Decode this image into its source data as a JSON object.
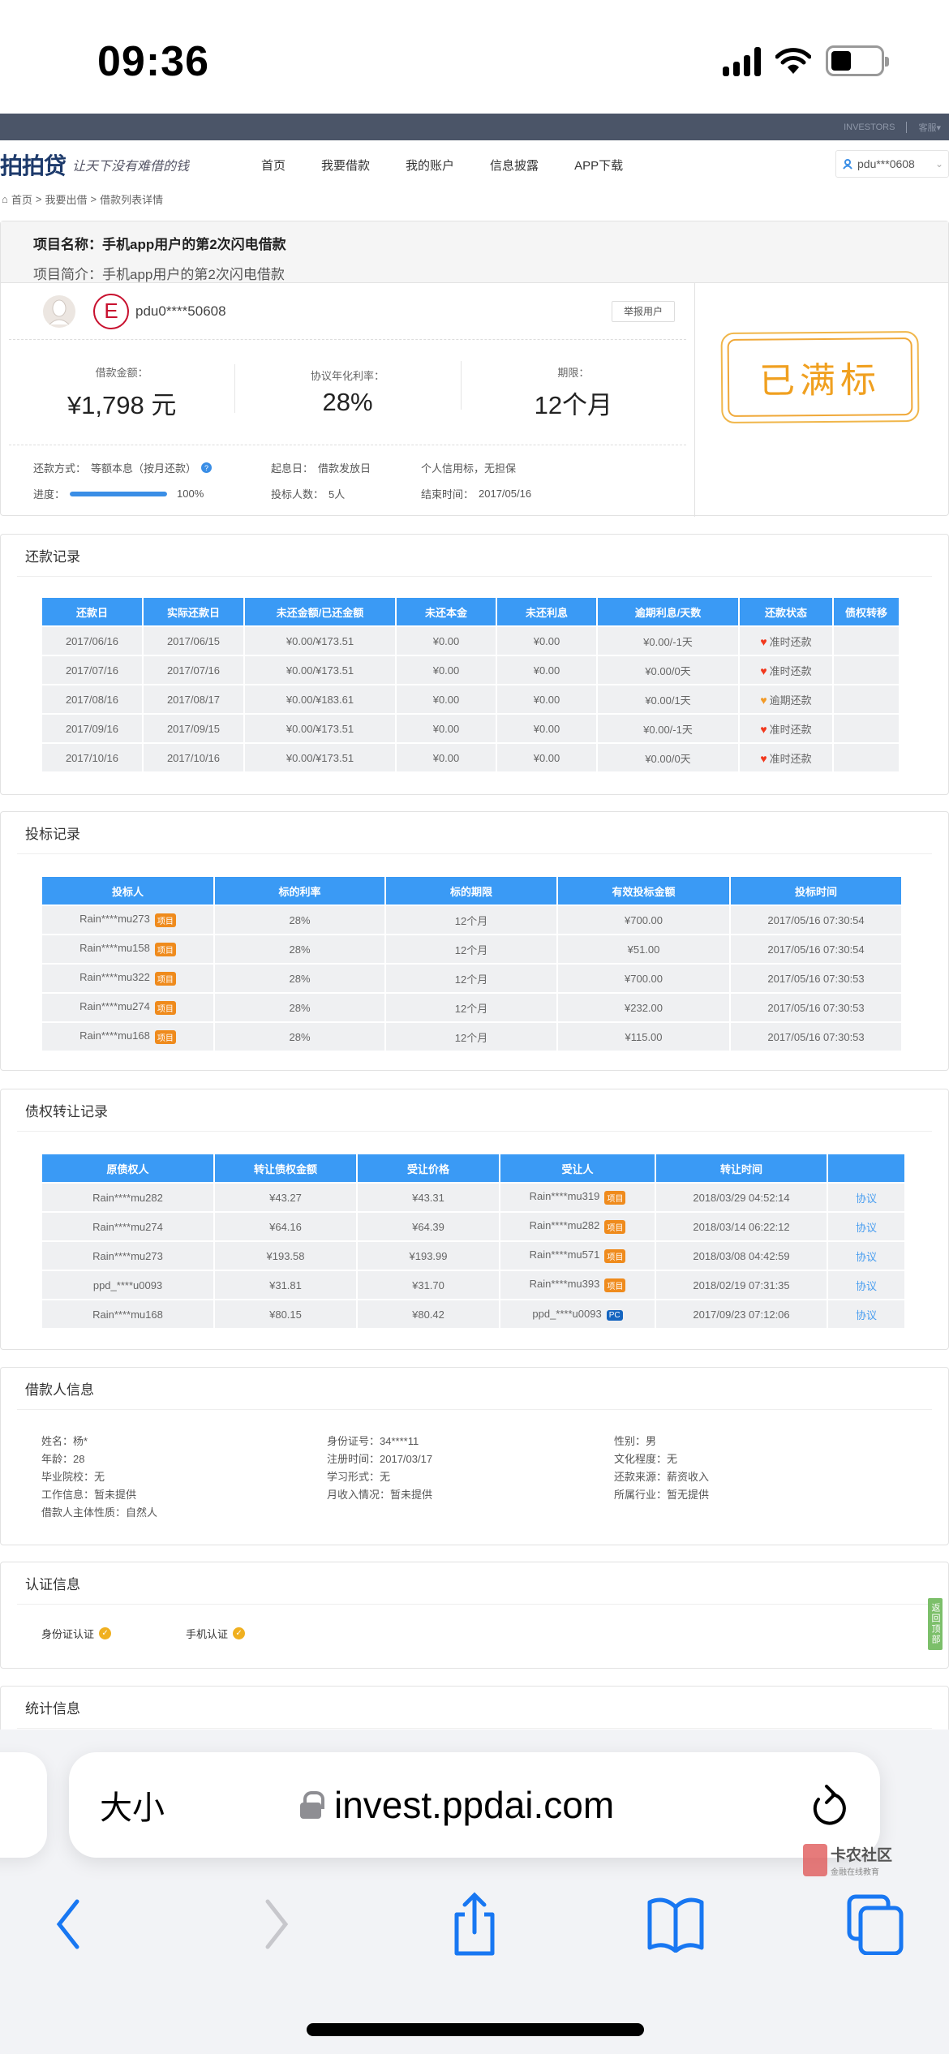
{
  "status_bar": {
    "time": "09:36"
  },
  "site": {
    "topbar": {
      "investors": "INVESTORS",
      "service": "客服"
    },
    "logo": "拍拍贷",
    "slogan": "让天下没有难借的钱",
    "nav": [
      "首页",
      "我要借款",
      "我的账户",
      "信息披露",
      "APP下载"
    ],
    "user": "pdu***0608",
    "breadcrumb": [
      "首页",
      "我要出借",
      "借款列表详情"
    ],
    "breadcrumb_sep": ">"
  },
  "project": {
    "name_label": "项目名称：",
    "name": "手机app用户的第2次闪电借款",
    "intro_label": "项目简介：",
    "intro": "手机app用户的第2次闪电借款",
    "borrower_level": "E",
    "borrower": "pdu0****50608",
    "report_button": "举报用户",
    "stats": [
      {
        "label": "借款金额：",
        "value": "¥1,798 元"
      },
      {
        "label": "协议年化利率：",
        "value": "28%"
      },
      {
        "label": "期限：",
        "value": "12个月"
      }
    ],
    "repay_method_label": "还款方式：",
    "repay_method": "等额本息（按月还款）",
    "interest_start_label": "起息日：",
    "interest_start": "借款发放日",
    "loan_type": "个人信用标，无担保",
    "progress_label": "进度：",
    "progress_percent": 100,
    "progress_text": "100%",
    "bidders_label": "投标人数：",
    "bidders": "5人",
    "end_time_label": "结束时间：",
    "end_time": "2017/05/16",
    "stamp": "已满标"
  },
  "repayment": {
    "title": "还款记录",
    "columns": [
      "还款日",
      "实际还款日",
      "未还金额/已还金额",
      "未还本金",
      "未还利息",
      "逾期利息/天数",
      "还款状态",
      "债权转移"
    ],
    "rows": [
      [
        "2017/06/16",
        "2017/06/15",
        "¥0.00/¥173.51",
        "¥0.00",
        "¥0.00",
        "¥0.00/-1天",
        "准时还款",
        ""
      ],
      [
        "2017/07/16",
        "2017/07/16",
        "¥0.00/¥173.51",
        "¥0.00",
        "¥0.00",
        "¥0.00/0天",
        "准时还款",
        ""
      ],
      [
        "2017/08/16",
        "2017/08/17",
        "¥0.00/¥183.61",
        "¥0.00",
        "¥0.00",
        "¥0.00/1天",
        "逾期还款",
        ""
      ],
      [
        "2017/09/16",
        "2017/09/15",
        "¥0.00/¥173.51",
        "¥0.00",
        "¥0.00",
        "¥0.00/-1天",
        "准时还款",
        ""
      ],
      [
        "2017/10/16",
        "2017/10/16",
        "¥0.00/¥173.51",
        "¥0.00",
        "¥0.00",
        "¥0.00/0天",
        "准时还款",
        ""
      ]
    ],
    "status_colors": {
      "准时还款": "#f2381d",
      "逾期还款": "#f29a27"
    }
  },
  "bids": {
    "title": "投标记录",
    "columns": [
      "投标人",
      "标的利率",
      "标的期限",
      "有效投标金额",
      "投标时间"
    ],
    "rows": [
      {
        "bidder": "Rain****mu273",
        "tag": "项目",
        "rate": "28%",
        "term": "12个月",
        "amount": "¥700.00",
        "time": "2017/05/16 07:30:54"
      },
      {
        "bidder": "Rain****mu158",
        "tag": "项目",
        "rate": "28%",
        "term": "12个月",
        "amount": "¥51.00",
        "time": "2017/05/16 07:30:54"
      },
      {
        "bidder": "Rain****mu322",
        "tag": "项目",
        "rate": "28%",
        "term": "12个月",
        "amount": "¥700.00",
        "time": "2017/05/16 07:30:53"
      },
      {
        "bidder": "Rain****mu274",
        "tag": "项目",
        "rate": "28%",
        "term": "12个月",
        "amount": "¥232.00",
        "time": "2017/05/16 07:30:53"
      },
      {
        "bidder": "Rain****mu168",
        "tag": "项目",
        "rate": "28%",
        "term": "12个月",
        "amount": "¥115.00",
        "time": "2017/05/16 07:30:53"
      }
    ]
  },
  "transfers": {
    "title": "债权转让记录",
    "columns": [
      "原债权人",
      "转让债权金额",
      "受让价格",
      "受让人",
      "转让时间",
      ""
    ],
    "rows": [
      {
        "from": "Rain****mu282",
        "amount": "¥43.27",
        "price": "¥43.31",
        "to": "Rain****mu319",
        "tag": "项目",
        "time": "2018/03/29 04:52:14",
        "link": "协议"
      },
      {
        "from": "Rain****mu274",
        "amount": "¥64.16",
        "price": "¥64.39",
        "to": "Rain****mu282",
        "tag": "项目",
        "time": "2018/03/14 06:22:12",
        "link": "协议"
      },
      {
        "from": "Rain****mu273",
        "amount": "¥193.58",
        "price": "¥193.99",
        "to": "Rain****mu571",
        "tag": "项目",
        "time": "2018/03/08 04:42:59",
        "link": "协议"
      },
      {
        "from": "ppd_****u0093",
        "amount": "¥31.81",
        "price": "¥31.70",
        "to": "Rain****mu393",
        "tag": "项目",
        "time": "2018/02/19 07:31:35",
        "link": "协议"
      },
      {
        "from": "Rain****mu168",
        "amount": "¥80.15",
        "price": "¥80.42",
        "to": "ppd_****u0093",
        "tag": "PC",
        "time": "2017/09/23 07:12:06",
        "link": "协议"
      }
    ]
  },
  "borrower_info": {
    "title": "借款人信息",
    "items": [
      {
        "label": "姓名：",
        "value": "杨*"
      },
      {
        "label": "身份证号：",
        "value": "34****11"
      },
      {
        "label": "性别：",
        "value": "男"
      },
      {
        "label": "年龄：",
        "value": "28"
      },
      {
        "label": "注册时间：",
        "value": "2017/03/17"
      },
      {
        "label": "文化程度：",
        "value": "无"
      },
      {
        "label": "毕业院校：",
        "value": "无"
      },
      {
        "label": "学习形式：",
        "value": "无"
      },
      {
        "label": "还款来源：",
        "value": "薪资收入"
      },
      {
        "label": "工作信息：",
        "value": "暂未提供"
      },
      {
        "label": "月收入情况：",
        "value": "暂未提供"
      },
      {
        "label": "所属行业：",
        "value": "暂无提供"
      },
      {
        "label": "借款人主体性质：",
        "value": "自然人"
      }
    ]
  },
  "auth_info": {
    "title": "认证信息",
    "items": [
      "身份证认证",
      "手机认证"
    ]
  },
  "stats_info": {
    "title": "统计信息"
  },
  "back_to_top": "返回顶部",
  "browser": {
    "text_size_button": "大小",
    "url": "invest.ppdai.com"
  },
  "watermark": {
    "title": "卡农社区",
    "subtitle": "金融在线教育"
  }
}
